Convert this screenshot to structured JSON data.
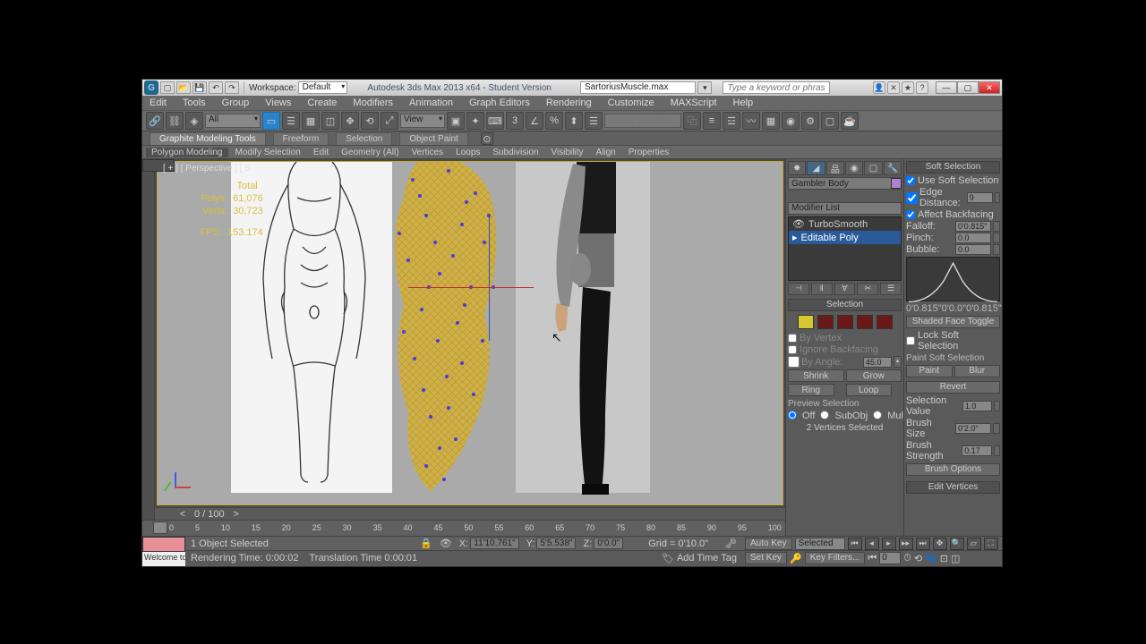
{
  "titlebar": {
    "workspace_label": "Workspace:",
    "workspace_value": "Default",
    "app_title": "Autodesk 3ds Max 2013 x64  -  Student Version",
    "filename": "SartoriusMuscle.max",
    "search_placeholder": "Type a keyword or phrase"
  },
  "menus": [
    "Edit",
    "Tools",
    "Group",
    "Views",
    "Create",
    "Modifiers",
    "Animation",
    "Graph Editors",
    "Rendering",
    "Customize",
    "MAXScript",
    "Help"
  ],
  "toolbar": {
    "filter_dd": "All",
    "view_dd": "View",
    "selset_placeholder": "Create Selection Se"
  },
  "ribbon": {
    "tabs": [
      "Graphite Modeling Tools",
      "Freeform",
      "Selection",
      "Object Paint"
    ],
    "subtabs": [
      "Polygon Modeling",
      "Modify Selection",
      "Edit",
      "Geometry (All)",
      "Vertices",
      "Loops",
      "Subdivision",
      "Visibility",
      "Align",
      "Properties"
    ]
  },
  "viewport": {
    "label": "[ + ] [ Perspective ] [ S",
    "stats": {
      "total": "Total",
      "polys_l": "Polys:",
      "polys_v": "61,076",
      "verts_l": "Verts:",
      "verts_v": "30,723",
      "fps_l": "FPS:",
      "fps_v": "153.174"
    },
    "frame_range": "0 / 100",
    "ticks": [
      "0",
      "5",
      "10",
      "15",
      "20",
      "25",
      "30",
      "35",
      "40",
      "45",
      "50",
      "55",
      "60",
      "65",
      "70",
      "75",
      "80",
      "85",
      "90",
      "95",
      "100"
    ]
  },
  "cmd": {
    "object_name": "Gambler Body",
    "modlist_dd": "Modifier List",
    "stack": [
      {
        "name": "TurboSmooth",
        "sel": false
      },
      {
        "name": "Editable Poly",
        "sel": true
      }
    ],
    "selection_hd": "Selection",
    "by_vertex": "By Vertex",
    "ignore_bf": "Ignore Backfacing",
    "by_angle": "By Angle:",
    "by_angle_v": "45.0",
    "shrink": "Shrink",
    "grow": "Grow",
    "ring": "Ring",
    "loop": "Loop",
    "preview_hd": "Preview Selection",
    "off": "Off",
    "subobj": "SubObj",
    "multi": "Multi",
    "status": "2 Vertices Selected"
  },
  "soft": {
    "hd": "Soft Selection",
    "use": "Use Soft Selection",
    "edge": "Edge Distance:",
    "edge_v": "9",
    "affect": "Affect Backfacing",
    "falloff": "Falloff:",
    "falloff_v": "0'0.815\"",
    "pinch": "Pinch:",
    "pinch_v": "0.0",
    "bubble": "Bubble:",
    "bubble_v": "0.0",
    "curve_l": "0'0.815\"",
    "curve_m": "0'0.0\"",
    "curve_r": "0'0.815\"",
    "shaded": "Shaded Face Toggle",
    "lock": "Lock Soft Selection",
    "paint_hd": "Paint Soft Selection",
    "paint": "Paint",
    "blur": "Blur",
    "revert": "Revert",
    "selval": "Selection Value",
    "selval_v": "1.0",
    "brush": "Brush Size",
    "brush_v": "0'2.0\"",
    "strength": "Brush Strength",
    "strength_v": "0.17",
    "options": "Brush Options",
    "editv": "Edit Vertices"
  },
  "status": {
    "selected": "1 Object Selected",
    "x": "X:",
    "xv": "11'10.761\"",
    "y": "Y:",
    "yv": "5'5.538\"",
    "z": "Z:",
    "zv": "0'0.0\"",
    "grid": "Grid = 0'10.0\"",
    "render": "Rendering Time: 0:00:02",
    "trans": "Translation Time  0:00:01",
    "addtag": "Add Time Tag",
    "autokey": "Auto Key",
    "autokey_dd": "Selected",
    "setkey": "Set Key",
    "keyfilters": "Key Filters...",
    "frame": "0",
    "welcome": "Welcome to M"
  }
}
